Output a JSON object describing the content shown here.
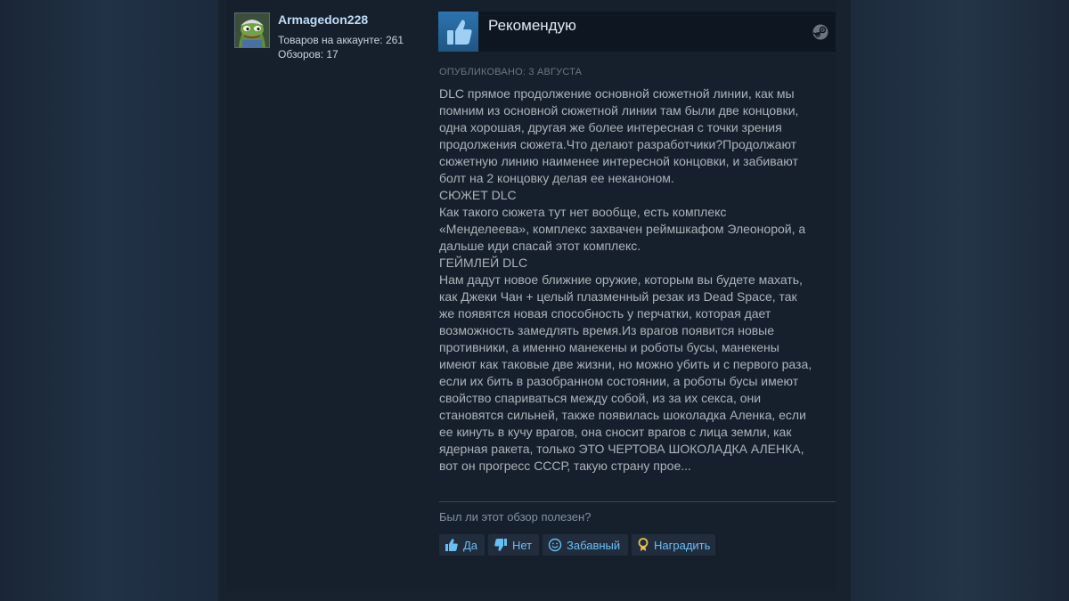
{
  "author": {
    "name": "Armagedon228",
    "products_label": "Товаров на аккаунте: 261",
    "reviews_label": "Обзоров: 17"
  },
  "review": {
    "verdict": "Рекомендую",
    "posted": "ОПУБЛИКОВАНО: 3 АВГУСТА",
    "lines": [
      "DLC прямое продолжение основной сюжетной линии, как мы",
      "помним из основной сюжетной линии там были две концовки,",
      "одна хорошая, другая же более интересная с точки зрения",
      "продолжения сюжета.Что делают разработчики?Продолжают",
      "сюжетную линию наименее интересной концовки, и забивают",
      "болт на 2 концовку делая ее неканоном.",
      "СЮЖЕТ DLC",
      "Как такого сюжета тут нет вообще, есть комплекс",
      "«Менделеева», комплекс захвачен реймшкафом Элеонорой, а",
      "дальше иди спасай этот комплекс.",
      "ГЕЙМЛЕЙ DLC",
      "Нам дадут новое ближние оружие, которым вы будете махать,",
      "как Джеки Чан + целый плазменный резак из Dead Space, так",
      "же появятся новая способность у перчатки, которая дает",
      "возможность замедлять время.Из врагов появится новые",
      "противники, а именно манекены и роботы бусы, манекены",
      "имеют как таковые две жизни, но можно убить и с первого раза,",
      "если их бить в разобранном состоянии, а роботы бусы имеют",
      "свойство спариваться между собой, из за их секса, они",
      "становятся сильней, также появилась шоколадка Аленка, если",
      "ее кинуть в кучу врагов, она сносит врагов с лица земли, как",
      "ядерная ракета, только ЭТО ЧЕРТОВА ШОКОЛАДКА АЛЕНКА,",
      "вот он прогресс СССР, такую страну прое..."
    ]
  },
  "feedback": {
    "question": "Был ли этот обзор полезен?",
    "yes": "Да",
    "no": "Нет",
    "funny": "Забавный",
    "award": "Наградить"
  },
  "icons": {
    "recommend": "thumbs-up-icon",
    "platform": "steam-icon",
    "yes": "thumbs-up-icon",
    "no": "thumbs-down-icon",
    "funny": "smiley-icon",
    "award": "award-icon"
  },
  "colors": {
    "link": "#66c0f4",
    "text": "#acb2b8",
    "author": "#c1dbf4"
  }
}
